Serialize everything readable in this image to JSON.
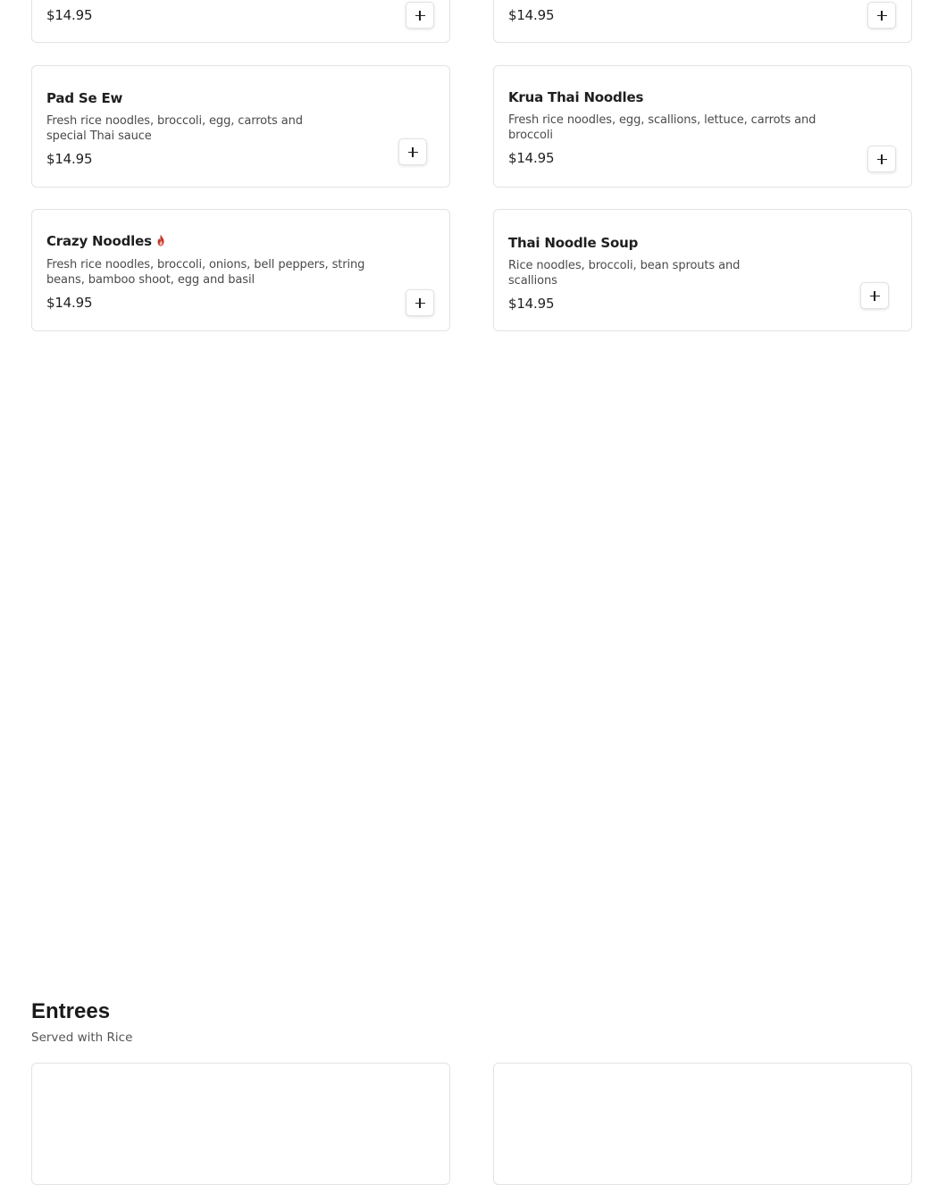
{
  "colors": {
    "spicy": "#c0392b",
    "border": "#e3e3e3"
  },
  "items": [
    {
      "price": "$14.95",
      "add_icon": "plus-icon"
    },
    {
      "price": "$14.95",
      "add_icon": "plus-icon"
    },
    {
      "name": "Pad Se Ew",
      "description": "Fresh rice noodles, broccoli, egg, carrots and special Thai sauce",
      "price": "$14.95",
      "add_icon": "plus-icon"
    },
    {
      "name": "Krua Thai Noodles",
      "description": "Fresh rice noodles, egg, scallions, lettuce, carrots and broccoli",
      "price": "$14.95",
      "add_icon": "plus-icon"
    },
    {
      "name": "Crazy Noodles",
      "spicy": true,
      "spicy_icon": "chili-flame-icon",
      "description": "Fresh rice noodles, broccoli, onions, bell peppers, string beans, bamboo shoot, egg and basil",
      "price": "$14.95",
      "add_icon": "plus-icon"
    },
    {
      "name": "Thai Noodle Soup",
      "description": "Rice noodles, broccoli, bean sprouts and scallions",
      "price": "$14.95",
      "add_icon": "plus-icon"
    }
  ],
  "section": {
    "title": "Entrees",
    "subtitle": "Served with Rice"
  }
}
